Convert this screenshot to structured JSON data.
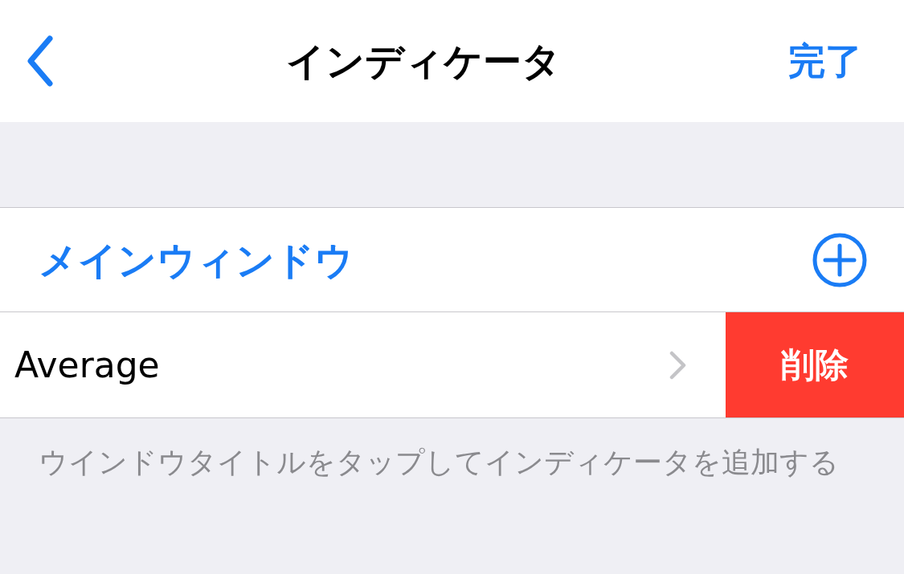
{
  "nav": {
    "title": "インディケータ",
    "done": "完了"
  },
  "section": {
    "title": "メインウィンドウ",
    "rows": [
      {
        "label": "Average",
        "action": "削除",
        "swiped": true
      }
    ]
  },
  "footer": "ウインドウタイトルをタップしてインディケータを追加する"
}
